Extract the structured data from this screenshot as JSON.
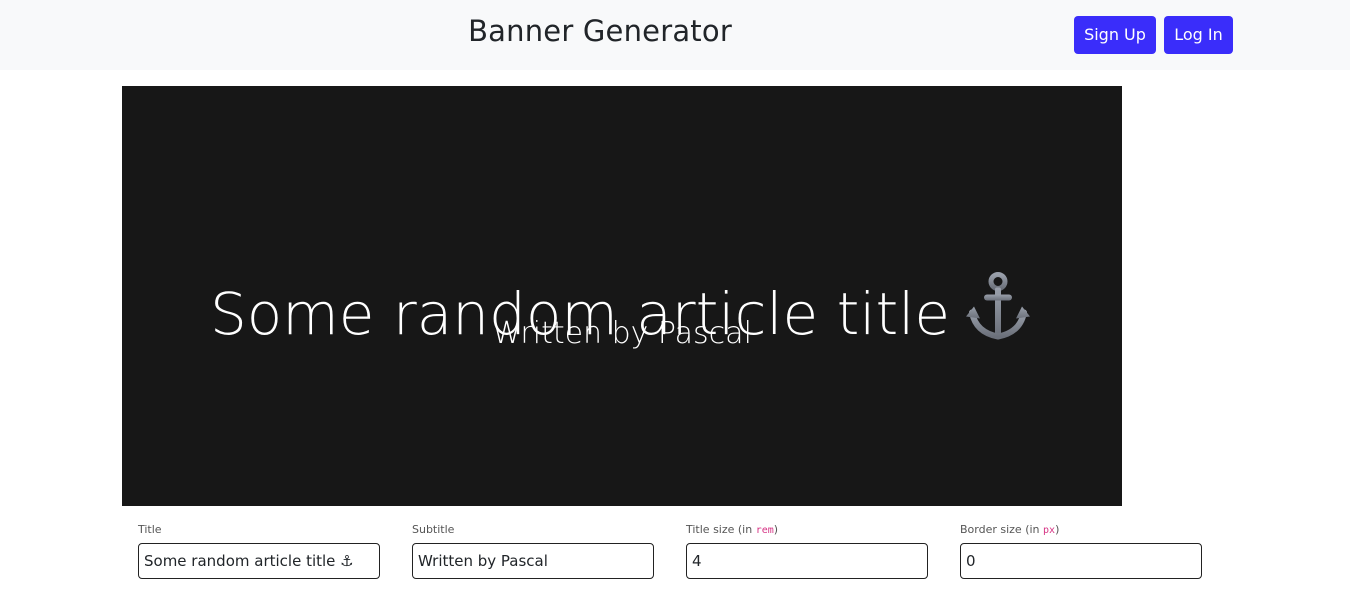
{
  "header": {
    "title": "Banner Generator",
    "signup_label": "Sign Up",
    "login_label": "Log In",
    "accent_color": "#3a2dfa"
  },
  "banner": {
    "title": "Some random article title",
    "title_icon": "anchor-icon",
    "subtitle": "Written by Pascal",
    "background_color": "#171717"
  },
  "form": {
    "title_field": {
      "label": "Title",
      "value": "Some random article title ⚓"
    },
    "subtitle_field": {
      "label": "Subtitle",
      "value": "Written by Pascal"
    },
    "title_size_field": {
      "label": "Title size (in ",
      "unit": "rem",
      "label_end": ")",
      "value": "4"
    },
    "border_size_field": {
      "label": "Border size (in ",
      "unit": "px",
      "label_end": ")",
      "value": "0"
    }
  }
}
